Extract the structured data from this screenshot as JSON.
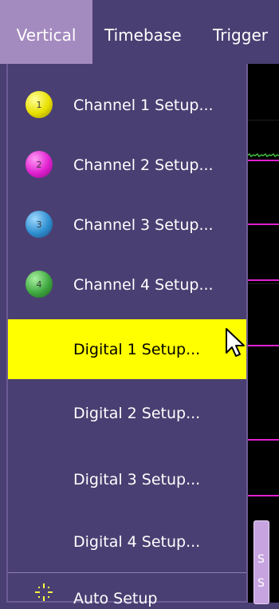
{
  "menubar": {
    "items": [
      {
        "label": "Vertical",
        "active": true
      },
      {
        "label": "Timebase",
        "active": false
      },
      {
        "label": "Trigger",
        "active": false
      }
    ]
  },
  "dropdown": {
    "items": [
      {
        "label": "Channel 1 Setup...",
        "badge": "1",
        "badge_color": "#e8e000",
        "icon": "channel-1-icon"
      },
      {
        "label": "Channel 2 Setup...",
        "badge": "2",
        "badge_color": "#e020d0",
        "icon": "channel-2-icon"
      },
      {
        "label": "Channel 3 Setup...",
        "badge": "3",
        "badge_color": "#2f8fd0",
        "icon": "channel-3-icon"
      },
      {
        "label": "Channel 4 Setup...",
        "badge": "4",
        "badge_color": "#3fa840",
        "icon": "channel-4-icon"
      },
      {
        "label": "Digital 1 Setup...",
        "highlighted": true
      },
      {
        "label": "Digital 2 Setup..."
      },
      {
        "label": "Digital 3 Setup..."
      },
      {
        "label": "Digital 4 Setup..."
      },
      {
        "label": "Auto Setup",
        "icon": "sparkle-icon"
      }
    ]
  },
  "colors": {
    "menu_bg": "#4a3f72",
    "active_tab": "#a48bbf",
    "highlight": "#ffff00",
    "scope_bg": "#000000",
    "trace_magenta": "#e020d0",
    "trace_green": "#40c040"
  },
  "scope_tag": "S"
}
